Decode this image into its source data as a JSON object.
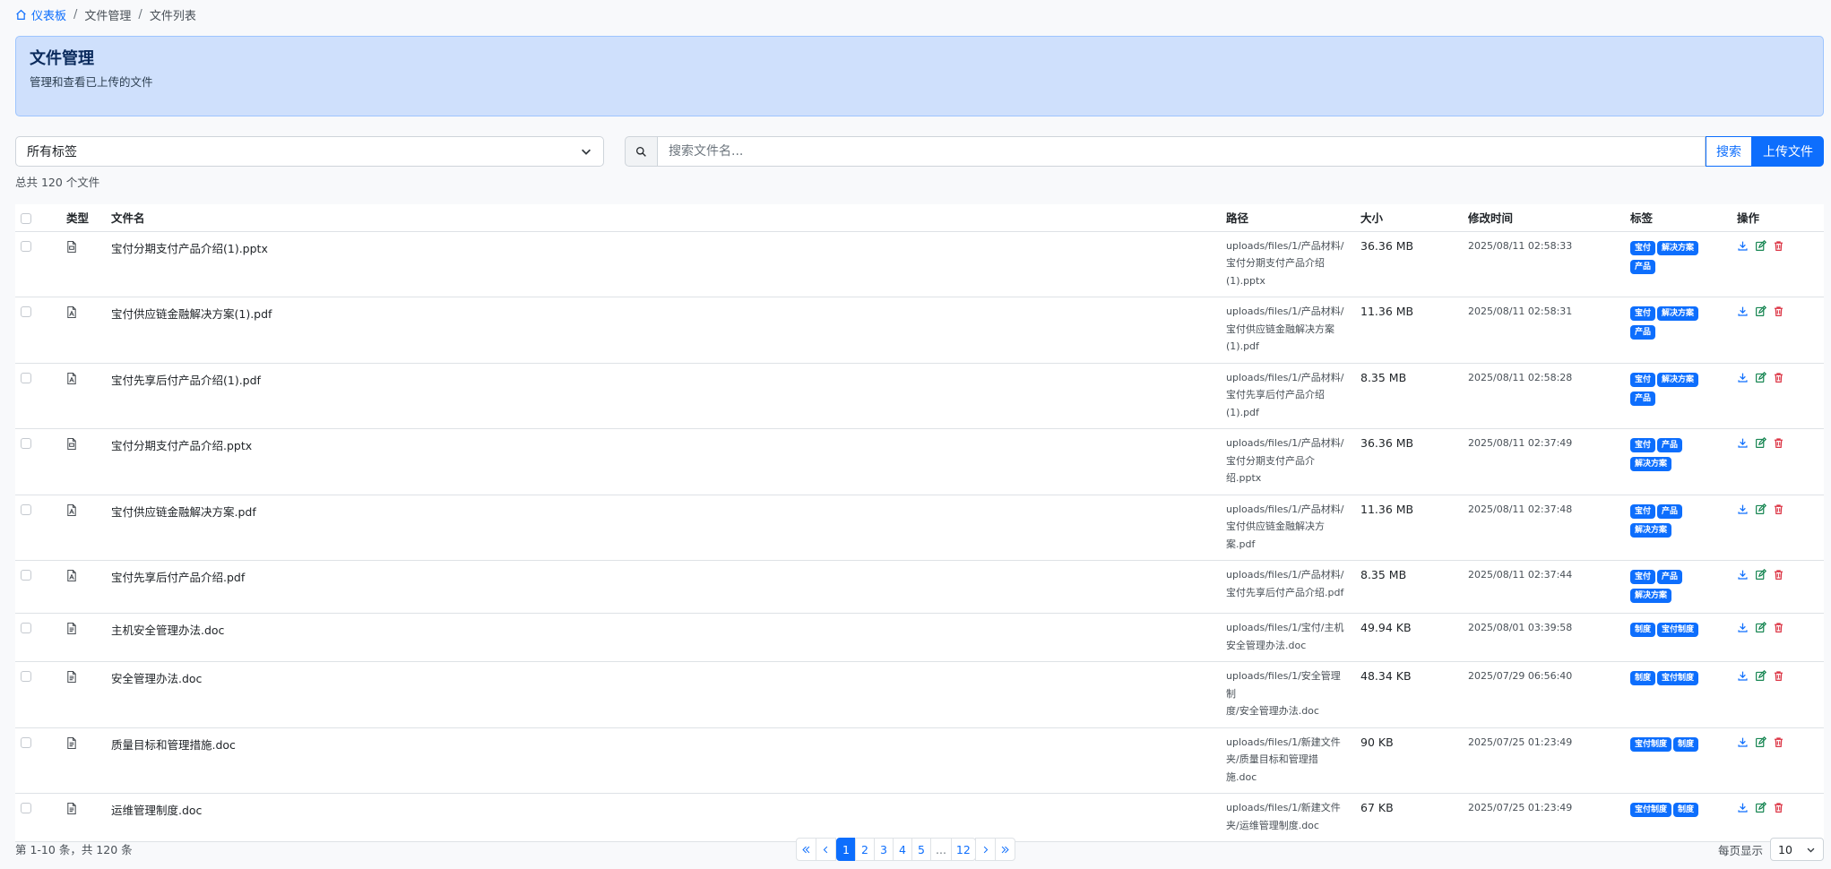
{
  "breadcrumb": {
    "home": "仪表板",
    "level2": "文件管理",
    "level3": "文件列表",
    "sep": "/"
  },
  "header": {
    "title": "文件管理",
    "subtitle": "管理和查看已上传的文件"
  },
  "filter": {
    "tag_select_value": "所有标签"
  },
  "search": {
    "placeholder": "搜索文件名...",
    "search_label": "搜索",
    "upload_label": "上传文件"
  },
  "summary": {
    "total_text": "总共 120 个文件"
  },
  "table": {
    "headers": {
      "type": "类型",
      "name": "文件名",
      "path": "路径",
      "size": "大小",
      "mtime": "修改时间",
      "tags": "标签",
      "ops": "操作"
    },
    "rows": [
      {
        "icon": "presentation-file-icon",
        "name": "宝付分期支付产品介绍(1).pptx",
        "path": [
          "uploads/files/1/产品材料/",
          "宝付分期支付产品介绍",
          "(1).pptx"
        ],
        "size": "36.36 MB",
        "mtime": "2025/08/11 02:58:33",
        "tags": [
          "宝付",
          "解决方案",
          "产品"
        ]
      },
      {
        "icon": "pdf-file-icon",
        "name": "宝付供应链金融解决方案(1).pdf",
        "path": [
          "uploads/files/1/产品材料/",
          "宝付供应链金融解决方案",
          "(1).pdf"
        ],
        "size": "11.36 MB",
        "mtime": "2025/08/11 02:58:31",
        "tags": [
          "宝付",
          "解决方案",
          "产品"
        ]
      },
      {
        "icon": "pdf-file-icon",
        "name": "宝付先享后付产品介绍(1).pdf",
        "path": [
          "uploads/files/1/产品材料/",
          "宝付先享后付产品介绍",
          "(1).pdf"
        ],
        "size": "8.35 MB",
        "mtime": "2025/08/11 02:58:28",
        "tags": [
          "宝付",
          "解决方案",
          "产品"
        ]
      },
      {
        "icon": "presentation-file-icon",
        "name": "宝付分期支付产品介绍.pptx",
        "path": [
          "uploads/files/1/产品材料/",
          "宝付分期支付产品介",
          "绍.pptx"
        ],
        "size": "36.36 MB",
        "mtime": "2025/08/11 02:37:49",
        "tags": [
          "宝付",
          "产品",
          "解决方案"
        ]
      },
      {
        "icon": "pdf-file-icon",
        "name": "宝付供应链金融解决方案.pdf",
        "path": [
          "uploads/files/1/产品材料/",
          "宝付供应链金融解决方",
          "案.pdf"
        ],
        "size": "11.36 MB",
        "mtime": "2025/08/11 02:37:48",
        "tags": [
          "宝付",
          "产品",
          "解决方案"
        ]
      },
      {
        "icon": "pdf-file-icon",
        "name": "宝付先享后付产品介绍.pdf",
        "path": [
          "uploads/files/1/产品材料/",
          "宝付先享后付产品介绍.pdf"
        ],
        "size": "8.35 MB",
        "mtime": "2025/08/11 02:37:44",
        "tags": [
          "宝付",
          "产品",
          "解决方案"
        ]
      },
      {
        "icon": "word-file-icon",
        "name": "主机安全管理办法.doc",
        "path": [
          "uploads/files/1/宝付/主机",
          "安全管理办法.doc"
        ],
        "size": "49.94 KB",
        "mtime": "2025/08/01 03:39:58",
        "tags": [
          "制度",
          "宝付制度"
        ]
      },
      {
        "icon": "word-file-icon",
        "name": "安全管理办法.doc",
        "path": [
          "uploads/files/1/安全管理制",
          "度/安全管理办法.doc"
        ],
        "size": "48.34 KB",
        "mtime": "2025/07/29 06:56:40",
        "tags": [
          "制度",
          "宝付制度"
        ]
      },
      {
        "icon": "word-file-icon",
        "name": "质量目标和管理措施.doc",
        "path": [
          "uploads/files/1/新建文件",
          "夹/质量目标和管理措",
          "施.doc"
        ],
        "size": "90 KB",
        "mtime": "2025/07/25 01:23:49",
        "tags": [
          "宝付制度",
          "制度"
        ]
      },
      {
        "icon": "word-file-icon",
        "name": "运维管理制度.doc",
        "path": [
          "uploads/files/1/新建文件",
          "夹/运维管理制度.doc"
        ],
        "size": "67 KB",
        "mtime": "2025/07/25 01:23:49",
        "tags": [
          "宝付制度",
          "制度"
        ]
      }
    ]
  },
  "pagination": {
    "info": "第 1-10 条，共 120 条",
    "pages": [
      "1",
      "2",
      "3",
      "4",
      "5",
      "...",
      "12"
    ],
    "current": "1"
  },
  "per_page": {
    "label": "每页显示",
    "value": "10"
  },
  "colors": {
    "primary": "#0d6efd",
    "header_bg": "#cfe0fc",
    "delete": "#dc3545",
    "edit": "#198754"
  }
}
